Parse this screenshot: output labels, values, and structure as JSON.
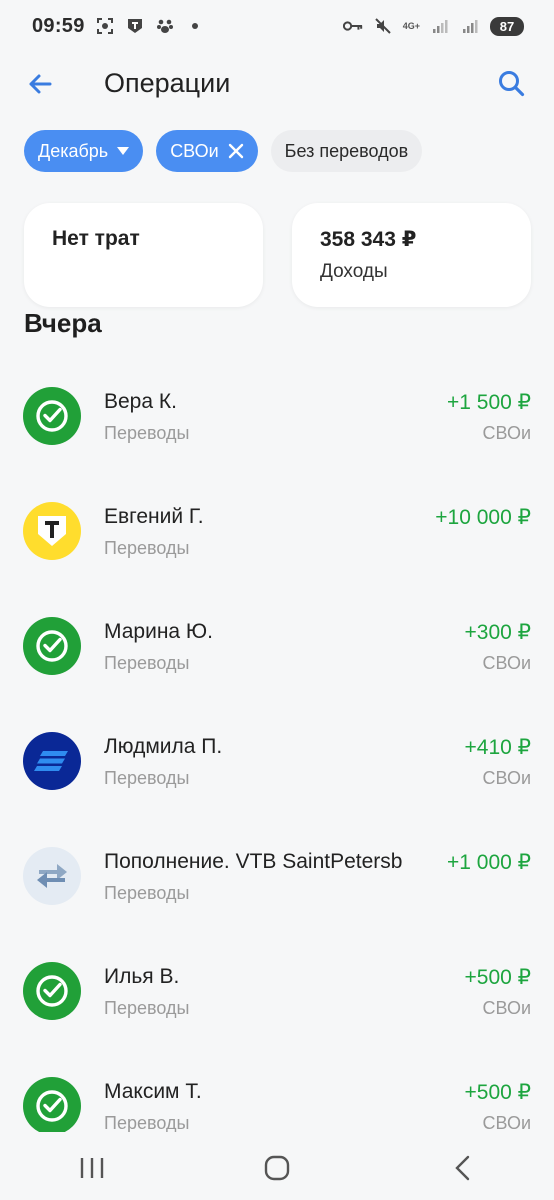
{
  "status_bar": {
    "time": "09:59",
    "network": "4G+",
    "battery": "87"
  },
  "header": {
    "title": "Операции"
  },
  "filters": [
    {
      "label": "Декабрь",
      "active": true,
      "tail": "chevron-down-icon"
    },
    {
      "label": "СВОи",
      "active": true,
      "tail": "close-icon"
    },
    {
      "label": "Без переводов",
      "active": false
    }
  ],
  "summary": {
    "spending": {
      "value": "Нет трат"
    },
    "income": {
      "value": "358 343 ₽",
      "label": "Доходы"
    }
  },
  "section_title": "Вчера",
  "operations": [
    {
      "name": "Вера К.",
      "category": "Переводы",
      "amount": "+1 500 ₽",
      "account": "СВОи",
      "icon": "sber-icon"
    },
    {
      "name": "Евгений Г.",
      "category": "Переводы",
      "amount": "+10 000 ₽",
      "account": "",
      "icon": "tbank-icon"
    },
    {
      "name": "Марина Ю.",
      "category": "Переводы",
      "amount": "+300 ₽",
      "account": "СВОи",
      "icon": "sber-icon"
    },
    {
      "name": "Людмила П.",
      "category": "Переводы",
      "amount": "+410 ₽",
      "account": "СВОи",
      "icon": "vtb-icon"
    },
    {
      "name": "Пополнение. VTB SaintPetersb",
      "category": "Переводы",
      "amount": "+1 000 ₽",
      "account": "",
      "icon": "transfer-arrows-icon"
    },
    {
      "name": "Илья В.",
      "category": "Переводы",
      "amount": "+500 ₽",
      "account": "СВОи",
      "icon": "sber-icon"
    },
    {
      "name": "Максим Т.",
      "category": "Переводы",
      "amount": "+500 ₽",
      "account": "СВОи",
      "icon": "sber-icon"
    }
  ],
  "colors": {
    "accent": "#4a8ef2",
    "income_green": "#1da53f",
    "sber_green": "#21a038",
    "tbank_yellow": "#ffdd2d",
    "vtb_blue": "#0a2896",
    "transfer_bg": "#e4ebf3"
  }
}
